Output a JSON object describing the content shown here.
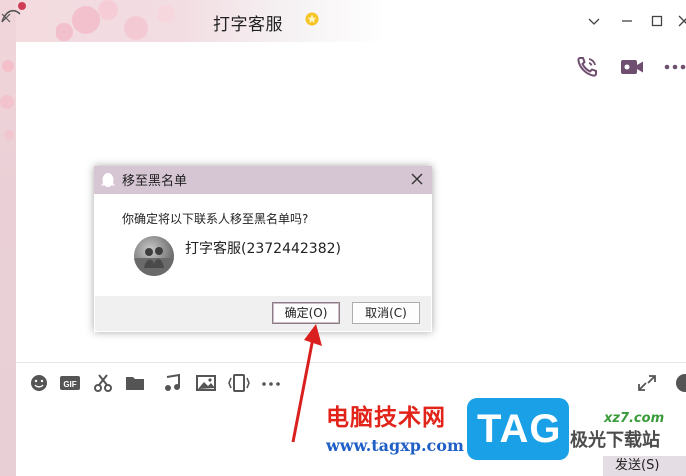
{
  "window": {
    "title": "打字客服"
  },
  "dialog": {
    "title": "移至黑名单",
    "message": "你确定将以下联系人移至黑名单吗?",
    "contact": "打字客服(2372442382)",
    "confirm_label": "确定(O)",
    "cancel_label": "取消(C)"
  },
  "toolbar": {
    "icons": [
      "emoji-icon",
      "gif-icon",
      "scissors-icon",
      "folder-icon",
      "music-icon",
      "image-icon",
      "screen-shake-icon",
      "more-icon"
    ]
  },
  "compose": {
    "send_label": "发送(S)"
  },
  "watermark": {
    "brand": "电脑技术网",
    "url": "www.tagxp.com",
    "logo": "TAG",
    "site": "极光下载站",
    "site_url": "xz7.com"
  },
  "colors": {
    "dialog_header": "#d6c5d3",
    "accent_purple": "#6f4f6f",
    "arrow_red": "#d9201e"
  }
}
